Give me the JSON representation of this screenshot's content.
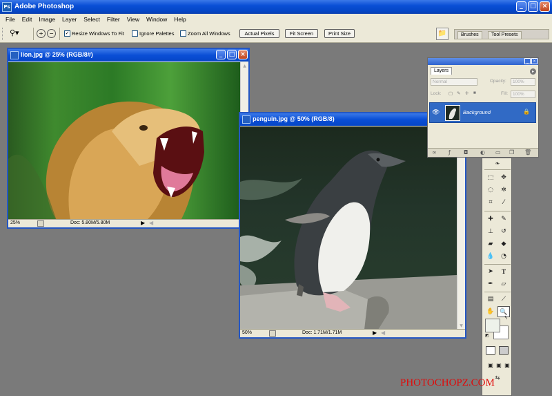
{
  "app": {
    "title": "Adobe Photoshop",
    "logo": "Ps",
    "window_buttons": [
      "_",
      "□",
      "×"
    ]
  },
  "menu": [
    "File",
    "Edit",
    "Image",
    "Layer",
    "Select",
    "Filter",
    "View",
    "Window",
    "Help"
  ],
  "options_bar": {
    "checks": [
      {
        "label": "Resize Windows To Fit",
        "checked": true
      },
      {
        "label": "Ignore Palettes",
        "checked": false
      },
      {
        "label": "Zoom All Windows",
        "checked": false
      }
    ],
    "buttons": [
      "Actual Pixels",
      "Fit Screen",
      "Print Size"
    ],
    "palette_tabs": [
      "Brushes",
      "Tool Presets"
    ]
  },
  "documents": {
    "lion": {
      "title": "lion.jpg @ 25% (RGB/8#)",
      "zoom": "25%",
      "doc": "Doc: 5.80M/5.80M"
    },
    "penguin": {
      "title": "penguin.jpg @ 50% (RGB/8)",
      "zoom": "50%",
      "doc": "Doc: 1.71M/1.71M"
    }
  },
  "layers_panel": {
    "tab": "Layers",
    "blend_mode": "Normal",
    "opacity_label": "Opacity:",
    "opacity_value": "100%",
    "lock_label": "Lock:",
    "fill_label": "Fill:",
    "fill_value": "100%",
    "layer_name": "Background"
  },
  "watermark": "PHOTOCHOPZ.COM",
  "colors": {
    "title_blue": "#0a4fd6",
    "selected_layer": "#316ac5",
    "watermark_red": "#e00a0a",
    "workspace": "#7a7a7a"
  }
}
